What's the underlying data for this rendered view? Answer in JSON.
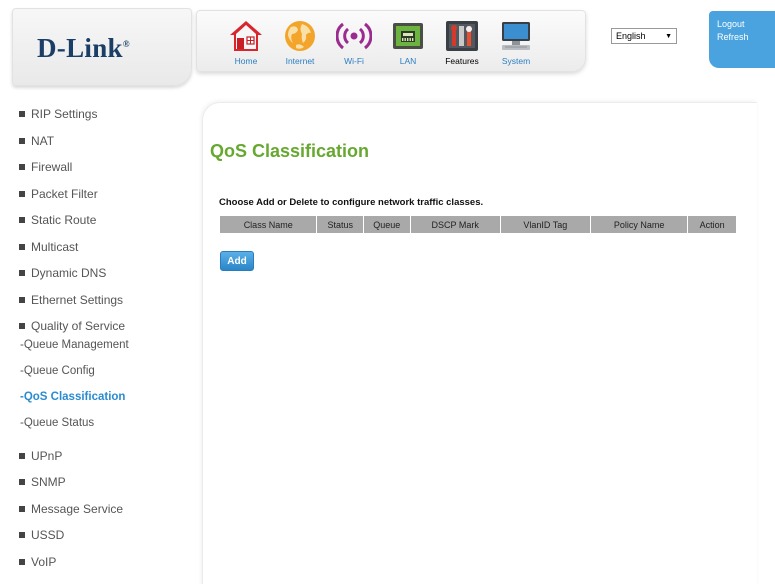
{
  "brand": {
    "logo_text": "D-Link",
    "logo_mark": "®"
  },
  "nav": [
    {
      "label": "Home",
      "icon": "home-icon"
    },
    {
      "label": "Internet",
      "icon": "globe-icon"
    },
    {
      "label": "Wi-Fi",
      "icon": "wifi-icon"
    },
    {
      "label": "LAN",
      "icon": "lan-icon"
    },
    {
      "label": "Features",
      "icon": "features-icon"
    },
    {
      "label": "System",
      "icon": "system-icon"
    }
  ],
  "active_nav": "Features",
  "language": {
    "selected": "English"
  },
  "account": {
    "logout": "Logout",
    "refresh": "Refresh"
  },
  "sidebar": {
    "items": [
      {
        "label": "RIP Settings"
      },
      {
        "label": "NAT"
      },
      {
        "label": "Firewall"
      },
      {
        "label": "Packet Filter"
      },
      {
        "label": "Static Route"
      },
      {
        "label": "Multicast"
      },
      {
        "label": "Dynamic DNS"
      },
      {
        "label": "Ethernet Settings"
      },
      {
        "label": "Quality of Service"
      },
      {
        "label": "UPnP"
      },
      {
        "label": "SNMP"
      },
      {
        "label": "Message Service"
      },
      {
        "label": "USSD"
      },
      {
        "label": "VoIP"
      }
    ],
    "sub_items": [
      {
        "label": "-Queue Management"
      },
      {
        "label": "-Queue Config"
      },
      {
        "label": "-QoS Classification"
      },
      {
        "label": "-Queue Status"
      }
    ],
    "active_sub": "-QoS Classification"
  },
  "main": {
    "title": "QoS Classification",
    "instructions": "Choose Add or Delete to configure network traffic classes.",
    "table_headers": [
      "Class Name",
      "Status",
      "Queue",
      "DSCP Mark",
      "VlanID Tag",
      "Policy Name",
      "Action"
    ],
    "add_label": "Add"
  },
  "colors": {
    "accent": "#66a830",
    "link": "#2a8bd0",
    "account_bg": "#4aa3df",
    "table_header": "#a9a9a9"
  }
}
